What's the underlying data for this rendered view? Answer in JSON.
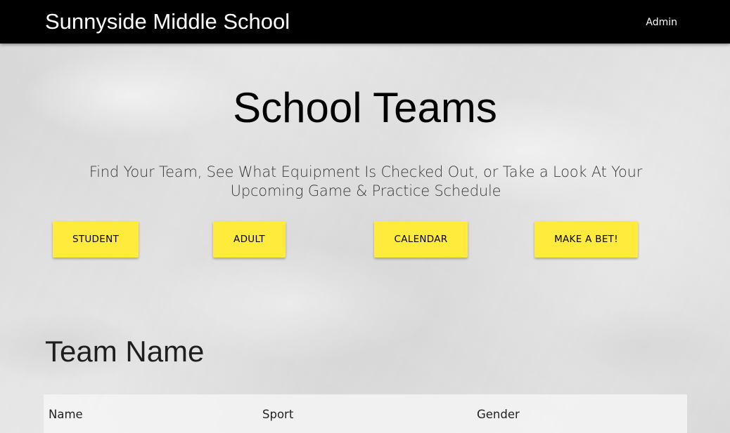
{
  "navbar": {
    "brand": "Sunnyside Middle School",
    "admin_link": "Admin"
  },
  "main": {
    "title": "School Teams",
    "subtitle": "Find Your Team, See What Equipment Is Checked Out, or Take a Look At Your Upcoming Game & Practice Schedule",
    "buttons": [
      {
        "label": "STUDENT"
      },
      {
        "label": "ADULT"
      },
      {
        "label": "CALENDAR"
      },
      {
        "label": "MAKE A BET!"
      }
    ],
    "button_color": "#ffeb3b"
  },
  "team_section": {
    "title": "Team Name",
    "table": {
      "headers": [
        "Name",
        "Sport",
        "Gender"
      ]
    }
  }
}
